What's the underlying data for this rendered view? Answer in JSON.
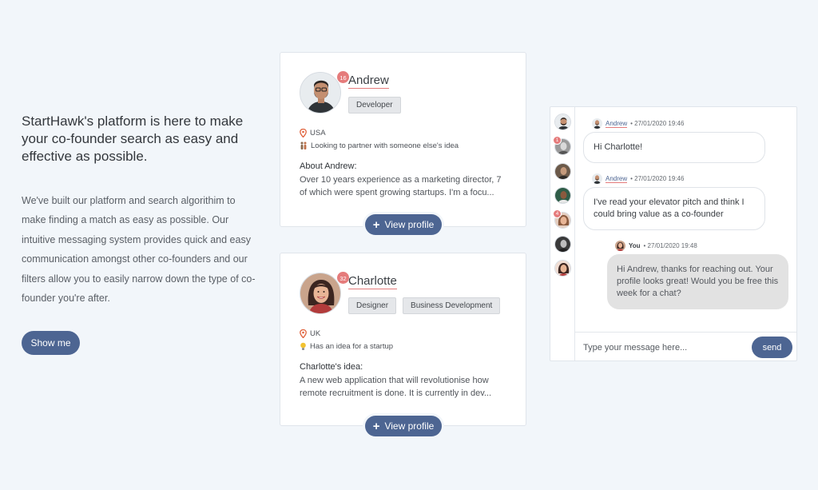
{
  "hero": {
    "title": "StartHawk's platform is here to make your co-founder search as easy and effective as possible.",
    "body": "We've built our platform and search algorithim to make finding a match as easy as possible. Our intuitive messaging system provides quick and easy communication amongst other co-founders and our filters allow you to easily narrow down the type of co-founder you're after.",
    "cta": "Show me"
  },
  "profiles": [
    {
      "name": "Andrew",
      "badge": "16",
      "tags": [
        "Developer"
      ],
      "location": "USA",
      "location_icon": "location-pin-icon",
      "intent": "Looking to partner with someone else's idea",
      "intent_icon": "people-icon",
      "about_title": "About Andrew:",
      "about_text": "Over 10 years experience as a marketing director, 7 of which were spent growing startups. I'm a focu...",
      "button": "View profile"
    },
    {
      "name": "Charlotte",
      "badge": "32",
      "tags": [
        "Designer",
        "Business Development"
      ],
      "location": "UK",
      "location_icon": "location-pin-icon",
      "intent": "Has an idea for a startup",
      "intent_icon": "lightbulb-icon",
      "about_title": "Charlotte's idea:",
      "about_text": "A new web application that will revolutionise how remote recruitment is done. It is currently in dev...",
      "button": "View profile"
    }
  ],
  "chat": {
    "contacts": [
      {
        "badge": ""
      },
      {
        "badge": "1"
      },
      {
        "badge": ""
      },
      {
        "badge": ""
      },
      {
        "badge": "4"
      },
      {
        "badge": ""
      },
      {
        "badge": ""
      }
    ],
    "messages": [
      {
        "author": "Andrew",
        "time": "• 27/01/2020 19:46",
        "text": "Hi Charlotte!"
      },
      {
        "author": "Andrew",
        "time": "• 27/01/2020 19:46",
        "text": "I've read your elevator pitch and think I could bring value as a co-founder"
      },
      {
        "author": "You",
        "time": "• 27/01/2020 19:48",
        "text": "Hi Andrew, thanks for reaching out. Your profile looks great! Would you be free this week for a chat?"
      }
    ],
    "input_placeholder": "Type your message here...",
    "send_label": "send"
  },
  "colors": {
    "accent": "#4d6592",
    "badge": "#e57b7b",
    "background": "#f2f6fa"
  }
}
